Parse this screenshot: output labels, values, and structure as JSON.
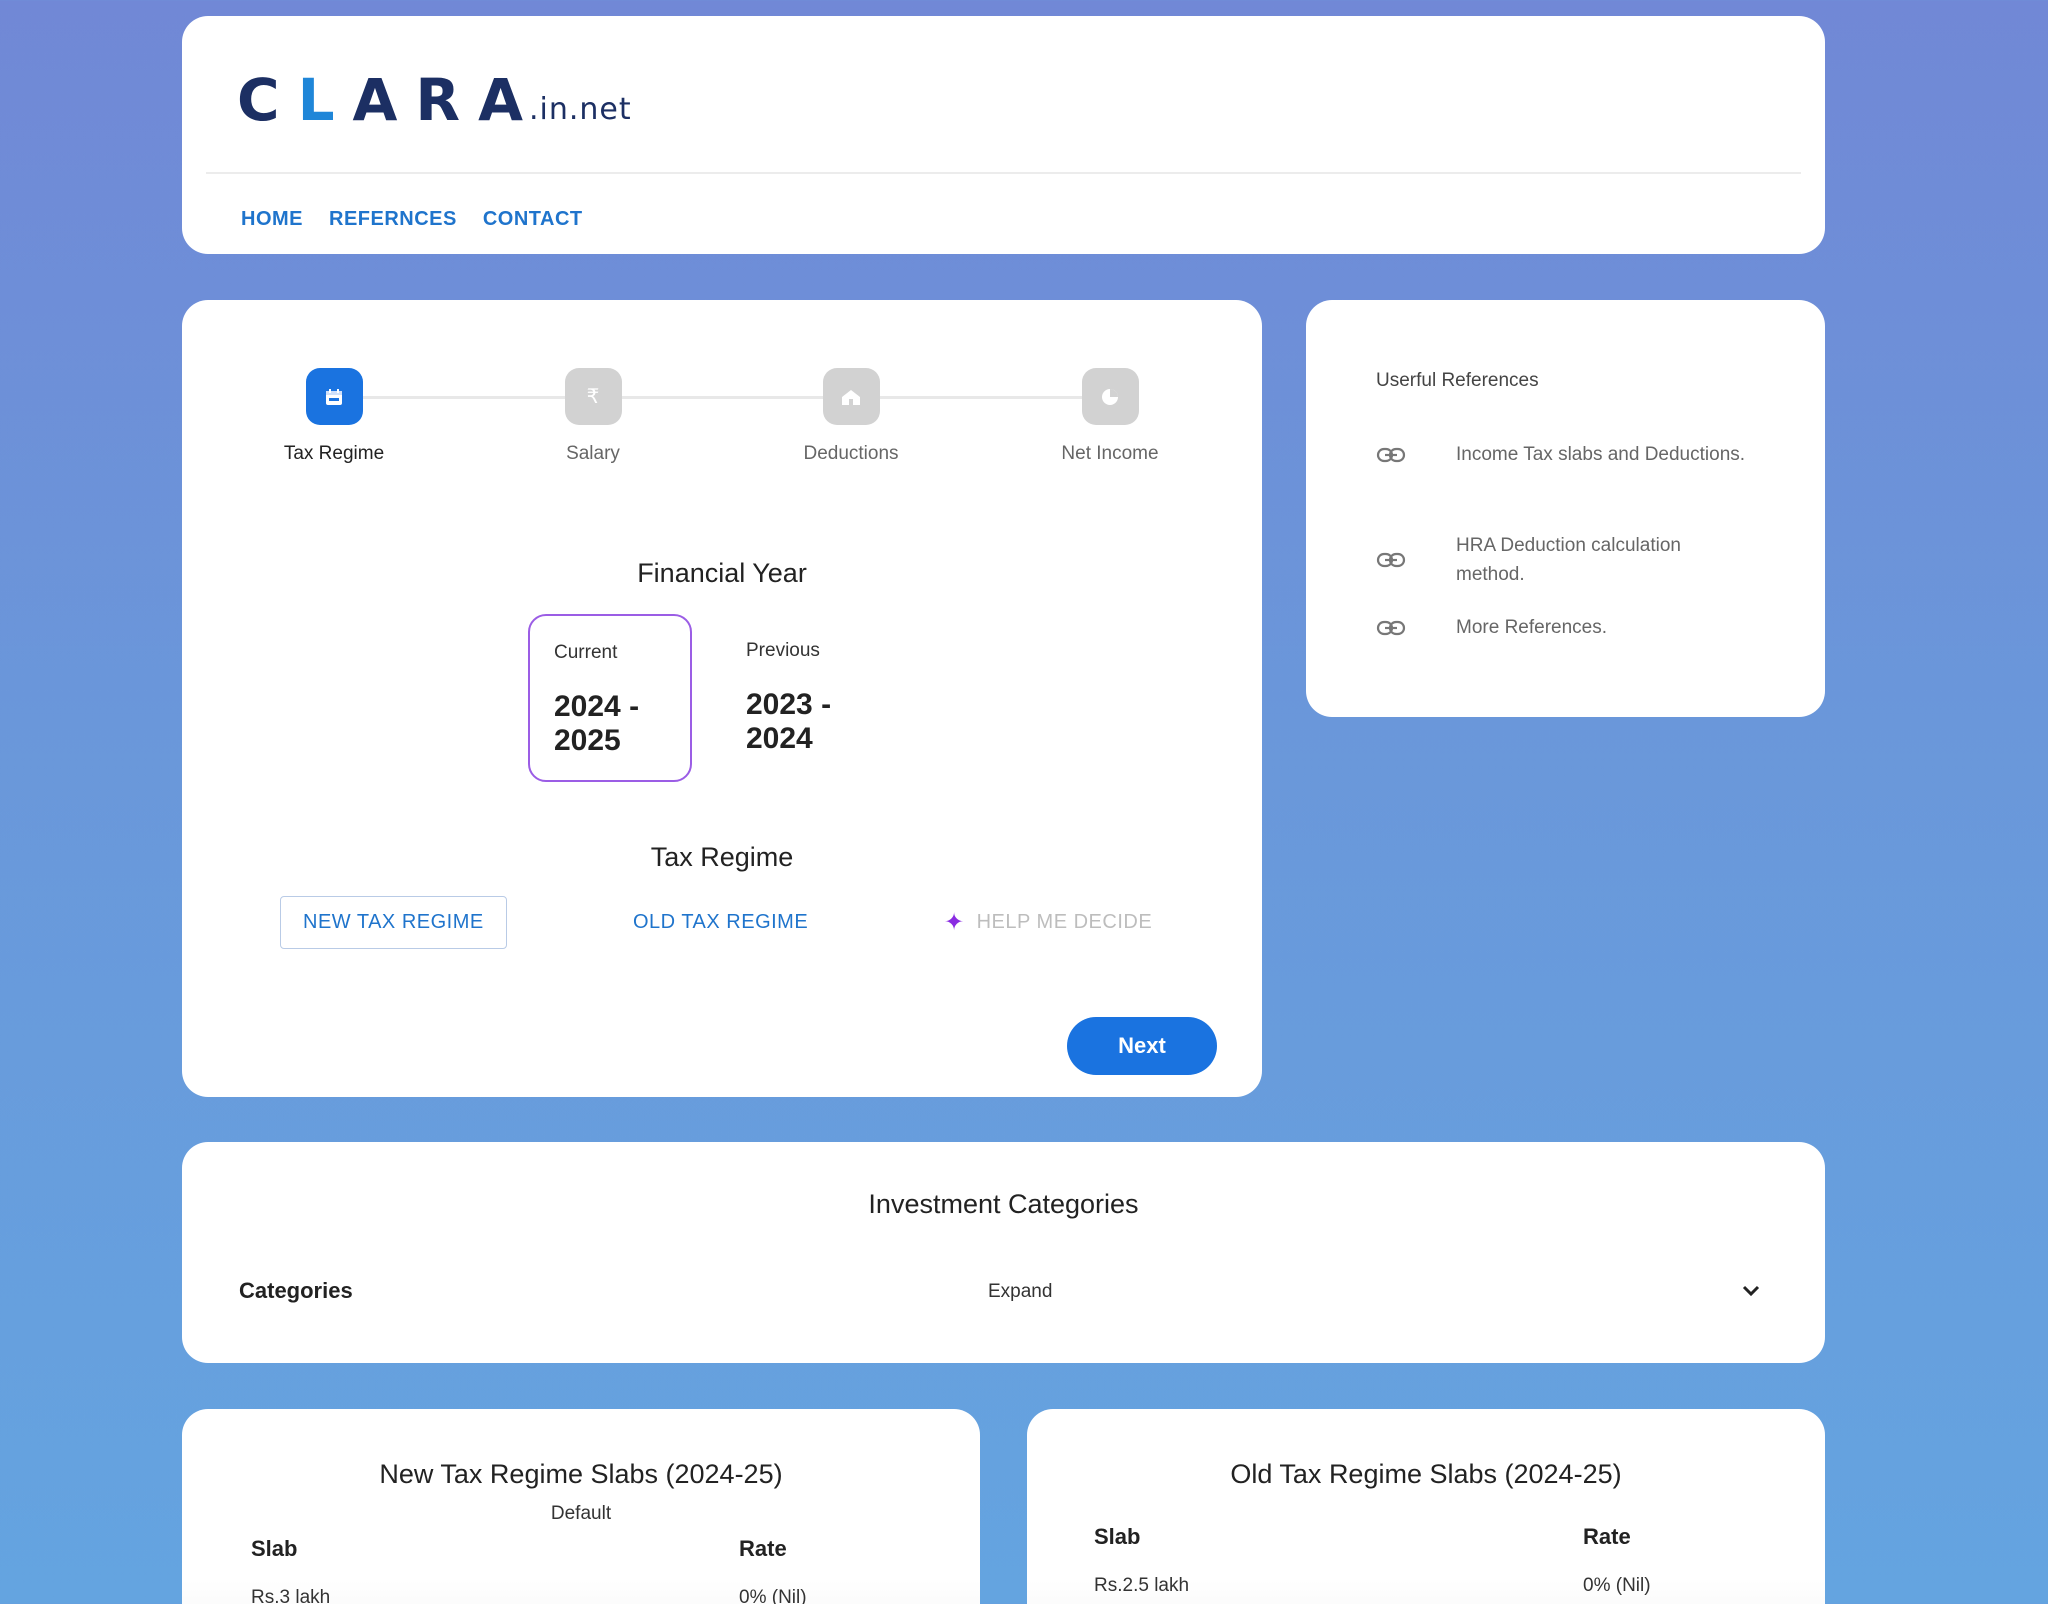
{
  "header": {
    "logo": {
      "main_a": "C",
      "main_b": "L",
      "main_c": "ARA",
      "sub": ".in.net"
    },
    "nav": [
      "HOME",
      "REFERNCES",
      "CONTACT"
    ]
  },
  "wizard": {
    "steps": [
      {
        "label": "Tax Regime",
        "icon": "calendar-icon",
        "active": true
      },
      {
        "label": "Salary",
        "icon": "rupee-icon",
        "active": false
      },
      {
        "label": "Deductions",
        "icon": "house-icon",
        "active": false
      },
      {
        "label": "Net Income",
        "icon": "pie-chart-icon",
        "active": false
      }
    ],
    "financial_year": {
      "title": "Financial Year",
      "options": [
        {
          "label": "Current",
          "value_line1": "2024 -",
          "value_line2": "2025",
          "selected": true
        },
        {
          "label": "Previous",
          "value_line1": "2023 -",
          "value_line2": "2024",
          "selected": false
        }
      ]
    },
    "tax_regime": {
      "title": "Tax Regime",
      "new_label": "NEW TAX REGIME",
      "old_label": "OLD TAX REGIME",
      "help_label": "HELP ME DECIDE"
    },
    "next_label": "Next"
  },
  "references": {
    "title": "Userful References",
    "items": [
      "Income Tax slabs and Deductions.",
      "HRA Deduction calculation method.",
      "More References."
    ]
  },
  "investment": {
    "title": "Investment Categories",
    "categories_label": "Categories",
    "expand_label": "Expand"
  },
  "slabs": {
    "new": {
      "title": "New Tax Regime Slabs (2024-25)",
      "subtitle": "Default",
      "headers": [
        "Slab",
        "Rate"
      ],
      "rows": [
        [
          "Rs.3 lakh",
          "0% (Nil)"
        ]
      ]
    },
    "old": {
      "title": "Old Tax Regime Slabs (2024-25)",
      "headers": [
        "Slab",
        "Rate"
      ],
      "rows": [
        [
          "Rs.2.5 lakh",
          "0% (Nil)"
        ]
      ]
    }
  },
  "colors": {
    "primary": "#1a73e0",
    "selected_border": "#9b5de5",
    "link": "#1f74cc",
    "logo_dark": "#1c2f63",
    "logo_accent": "#1f86d8"
  }
}
